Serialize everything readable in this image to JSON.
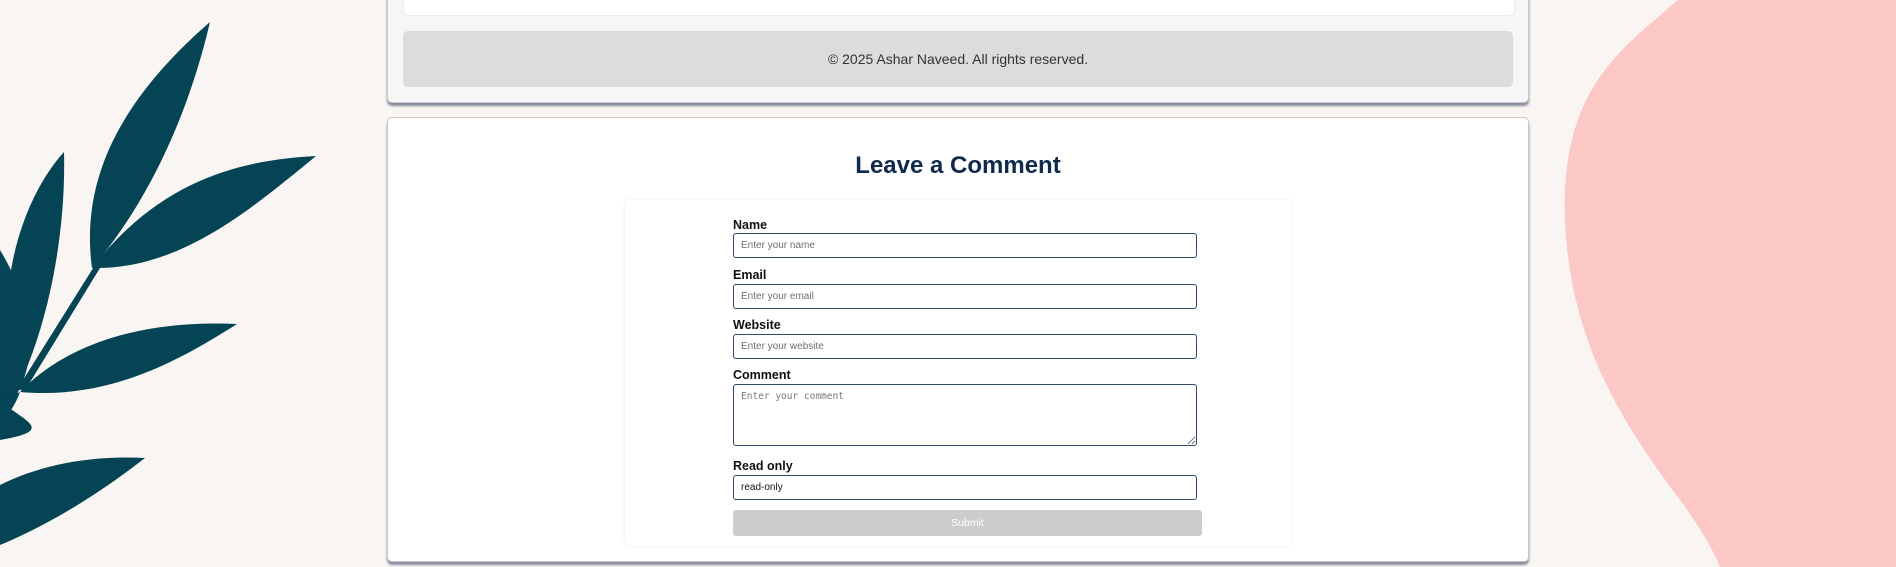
{
  "footer": {
    "copyright": "© 2025 Ashar Naveed. All rights reserved."
  },
  "comment_section": {
    "title": "Leave a Comment",
    "fields": {
      "name": {
        "label": "Name",
        "placeholder": "Enter your name",
        "value": ""
      },
      "email": {
        "label": "Email",
        "placeholder": "Enter your email",
        "value": ""
      },
      "website": {
        "label": "Website",
        "placeholder": "Enter your website",
        "value": ""
      },
      "comment": {
        "label": "Comment",
        "placeholder": "Enter your comment",
        "value": ""
      },
      "readonly": {
        "label": "Read only",
        "value": "read-only"
      }
    },
    "submit_label": "Submit"
  },
  "colors": {
    "page_background": "#f9f5f3",
    "leaf_decoration": "#044454",
    "blob_decoration": "#fcc8c6",
    "heading": "#0f2a4d",
    "footer_bar": "#dcdcdc",
    "submit_disabled": "#cccccc"
  },
  "icons": {
    "left_decoration": "leaf-branch-icon",
    "right_decoration": "pink-blob-shape"
  }
}
